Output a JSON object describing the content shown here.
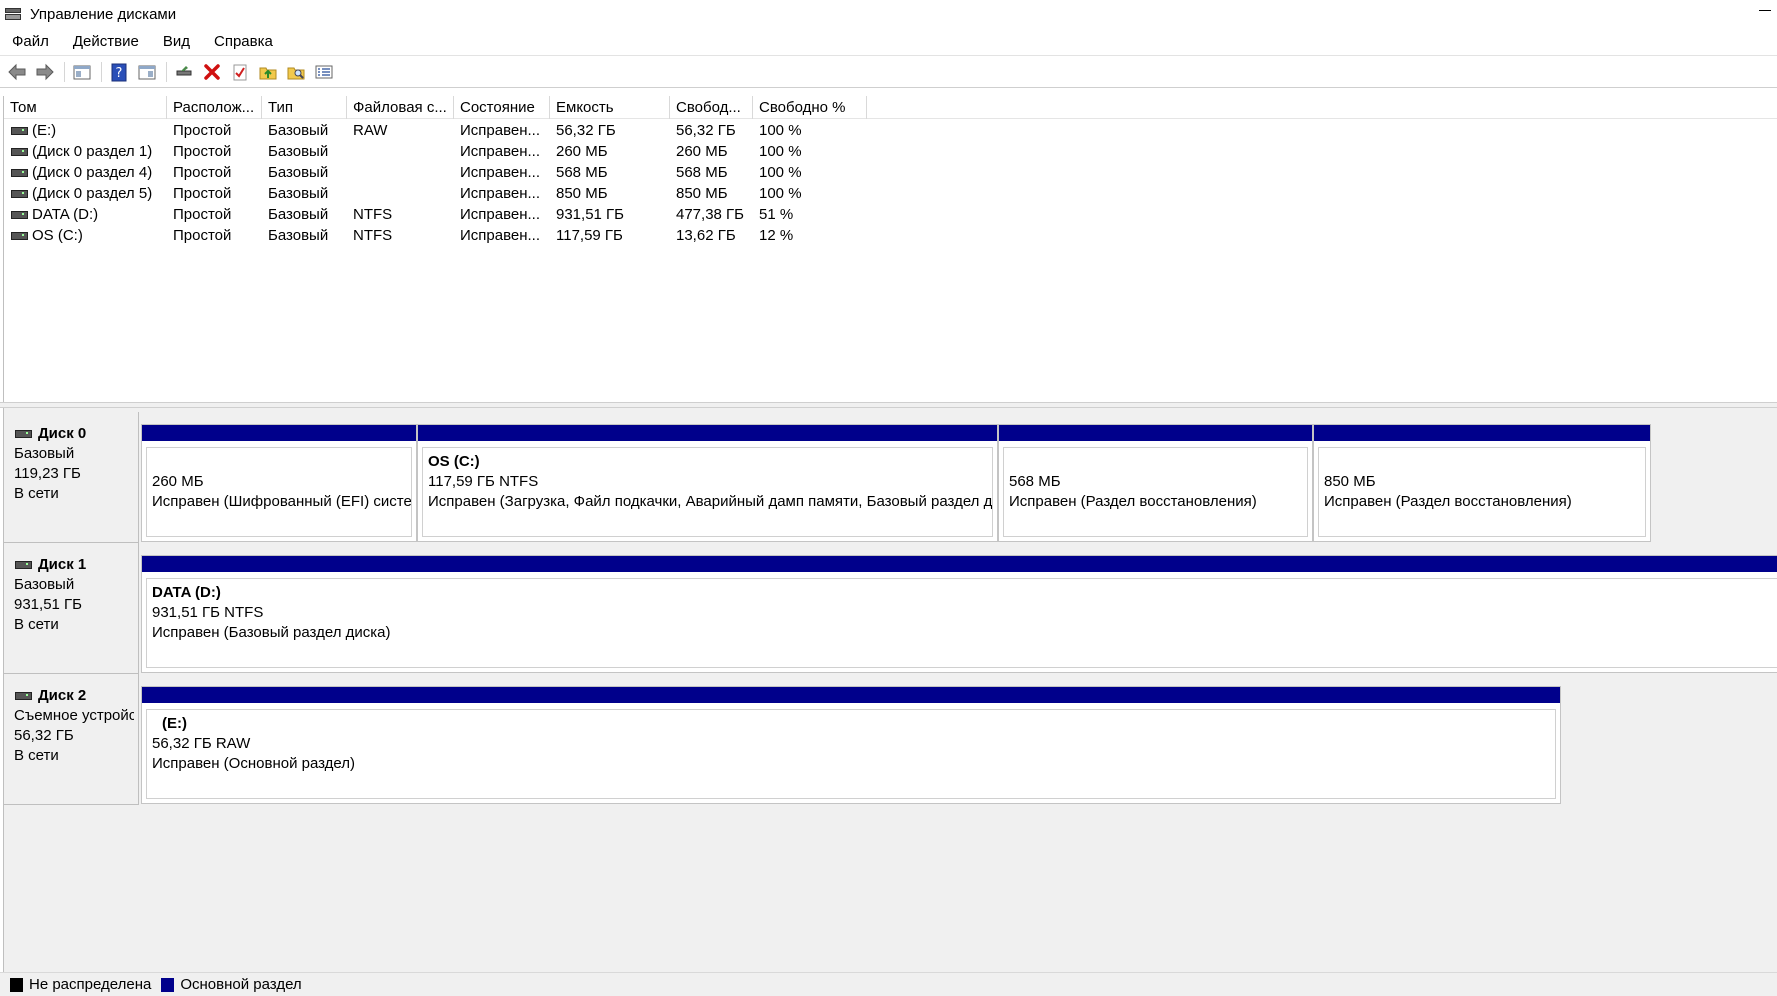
{
  "window": {
    "title": "Управление дисками"
  },
  "menu": [
    "Файл",
    "Действие",
    "Вид",
    "Справка"
  ],
  "toolbar": [
    "back-icon",
    "forward-icon",
    "console-tree-icon",
    "help-icon",
    "properties-view-icon",
    "connect-icon",
    "delete-icon",
    "check-icon",
    "up-folder-icon",
    "search-folder-icon",
    "list-view-icon"
  ],
  "columns": [
    "Том",
    "Располож...",
    "Тип",
    "Файловая с...",
    "Состояние",
    "Емкость",
    "Свобод...",
    "Свободно %"
  ],
  "volumes": [
    {
      "vol": "(E:)",
      "layout": "Простой",
      "type": "Базовый",
      "fs": "RAW",
      "status": "Исправен...",
      "capacity": "56,32 ГБ",
      "free": "56,32 ГБ",
      "pct": "100 %"
    },
    {
      "vol": "(Диск 0 раздел 1)",
      "layout": "Простой",
      "type": "Базовый",
      "fs": "",
      "status": "Исправен...",
      "capacity": "260 МБ",
      "free": "260 МБ",
      "pct": "100 %"
    },
    {
      "vol": "(Диск 0 раздел 4)",
      "layout": "Простой",
      "type": "Базовый",
      "fs": "",
      "status": "Исправен...",
      "capacity": "568 МБ",
      "free": "568 МБ",
      "pct": "100 %"
    },
    {
      "vol": "(Диск 0 раздел 5)",
      "layout": "Простой",
      "type": "Базовый",
      "fs": "",
      "status": "Исправен...",
      "capacity": "850 МБ",
      "free": "850 МБ",
      "pct": "100 %"
    },
    {
      "vol": "DATA (D:)",
      "layout": "Простой",
      "type": "Базовый",
      "fs": "NTFS",
      "status": "Исправен...",
      "capacity": "931,51 ГБ",
      "free": "477,38 ГБ",
      "pct": "51 %"
    },
    {
      "vol": "OS (C:)",
      "layout": "Простой",
      "type": "Базовый",
      "fs": "NTFS",
      "status": "Исправен...",
      "capacity": "117,59 ГБ",
      "free": "13,62 ГБ",
      "pct": "12 %"
    }
  ],
  "disks": [
    {
      "name": "Диск 0",
      "type": "Базовый",
      "size": "119,23 ГБ",
      "status": "В сети",
      "partitions": [
        {
          "name": "",
          "size": "260 МБ",
          "status": "Исправен (Шифрованный (EFI) систем"
        },
        {
          "name": "OS  (C:)",
          "size": "117,59 ГБ NTFS",
          "status": "Исправен (Загрузка, Файл подкачки, Аварийный дамп памяти, Базовый раздел д"
        },
        {
          "name": "",
          "size": "568 МБ",
          "status": "Исправен (Раздел восстановления)"
        },
        {
          "name": "",
          "size": "850 МБ",
          "status": "Исправен (Раздел восстановления)"
        }
      ]
    },
    {
      "name": "Диск 1",
      "type": "Базовый",
      "size": "931,51 ГБ",
      "status": "В сети",
      "partitions": [
        {
          "name": "DATA  (D:)",
          "size": "931,51 ГБ NTFS",
          "status": "Исправен (Базовый раздел диска)"
        }
      ]
    },
    {
      "name": "Диск 2",
      "type": "Съемное устройство",
      "size": "56,32 ГБ",
      "status": "В сети",
      "partitions": [
        {
          "name": "(E:)",
          "size": "56,32 ГБ RAW",
          "status": "Исправен (Основной раздел)"
        }
      ]
    }
  ],
  "legend": [
    {
      "label": "Не распределена",
      "color": "#000000"
    },
    {
      "label": "Основной раздел",
      "color": "#00008b"
    }
  ]
}
